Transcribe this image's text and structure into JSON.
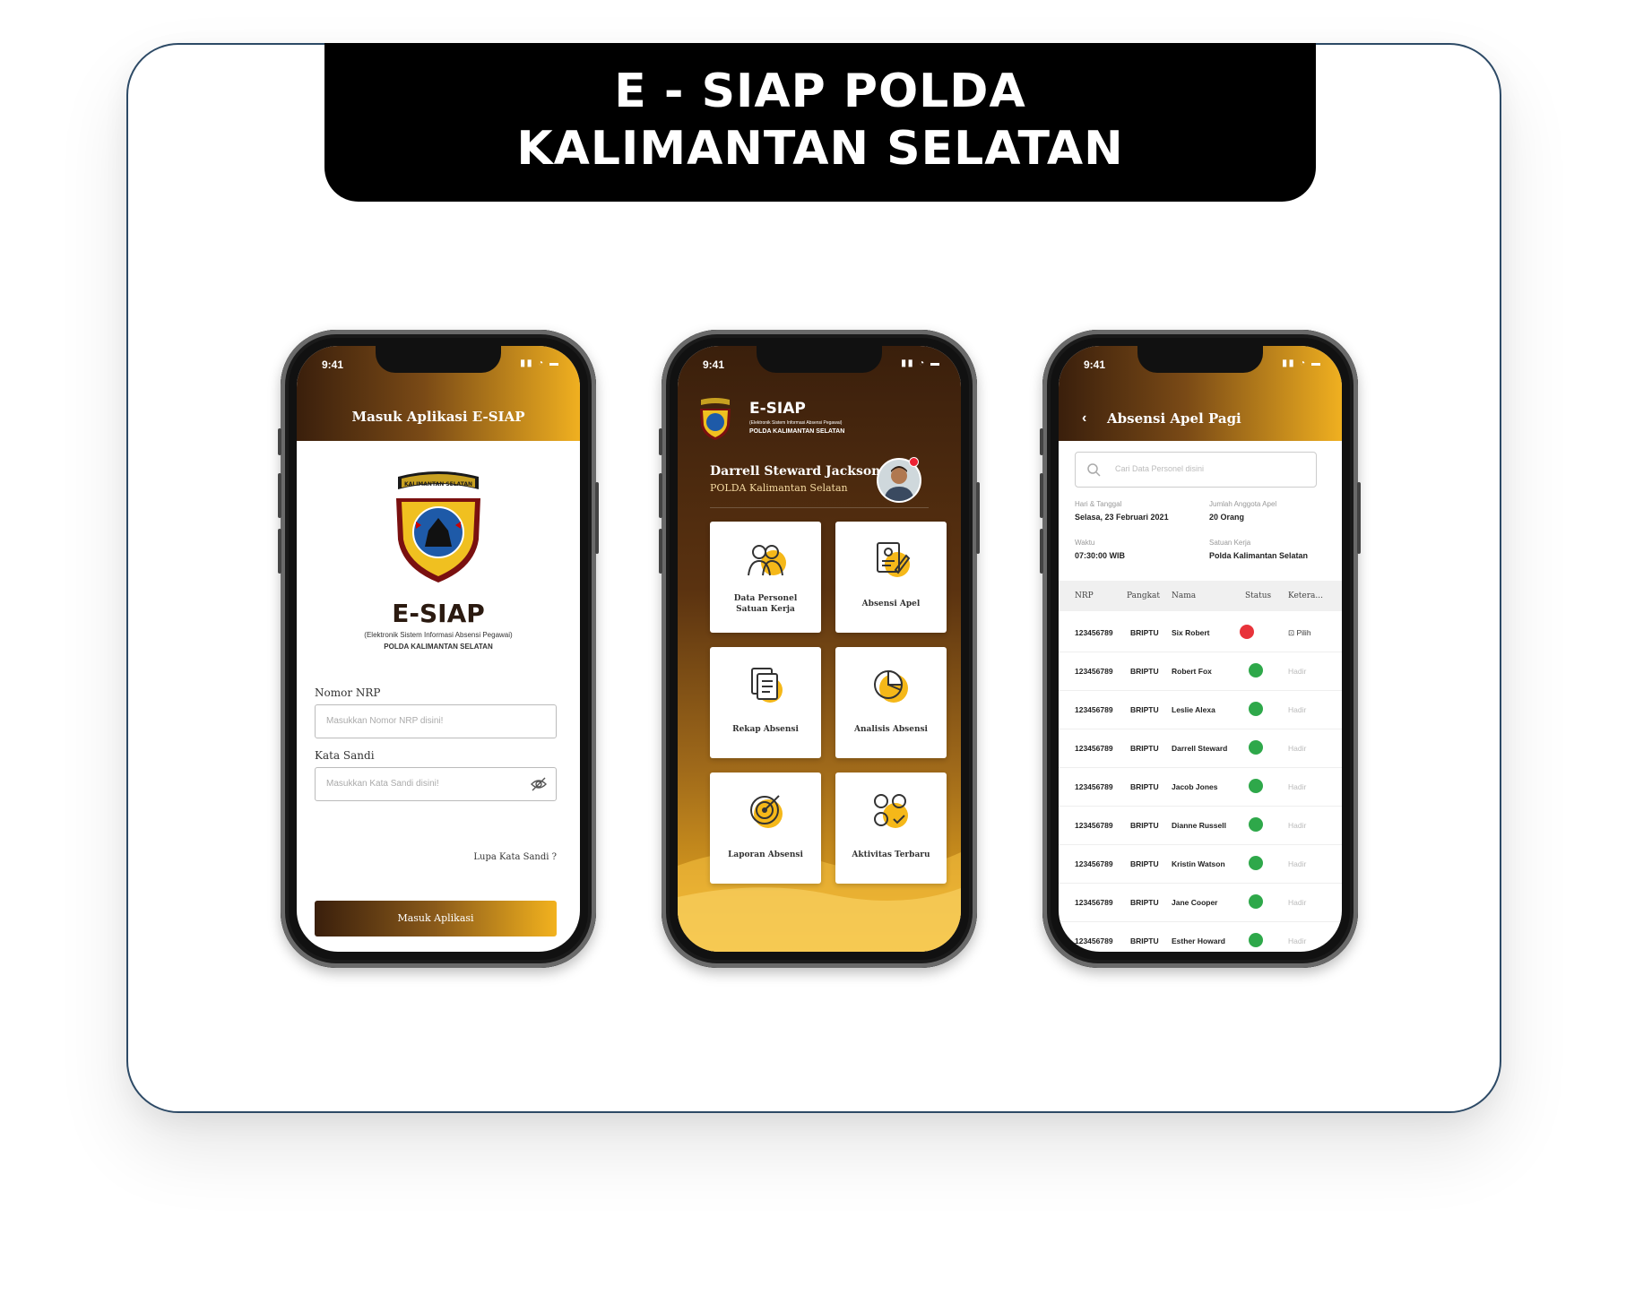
{
  "banner": {
    "line1": "E - SIAP POLDA",
    "line2": "KALIMANTAN SELATAN"
  },
  "status_time": "9:41",
  "login": {
    "header_title": "Masuk Aplikasi E-SIAP",
    "app_name": "E-SIAP",
    "app_subtitle": "(Elektronik Sistem Informasi Absensi Pegawai)",
    "org": "POLDA KALIMANTAN SELATAN",
    "logo_banner_text": "KALIMANTAN SELATAN",
    "nrp_label": "Nomor NRP",
    "nrp_placeholder": "Masukkan Nomor NRP disini!",
    "password_label": "Kata Sandi",
    "password_placeholder": "Masukkan Kata Sandi disini!",
    "forgot": "Lupa Kata Sandi ?",
    "submit": "Masuk Aplikasi"
  },
  "dashboard": {
    "app_name": "E-SIAP",
    "app_subtitle": "(Elektronik Sistem Informasi Absensi Pegawai)",
    "org": "POLDA KALIMANTAN SELATAN",
    "user_name": "Darrell Steward Jackson",
    "user_org": "POLDA Kalimantan Selatan",
    "tiles": [
      {
        "label1": "Data Personel",
        "label2": "Satuan Kerja",
        "icon": "personnel-icon"
      },
      {
        "label1": "Absensi Apel",
        "label2": "",
        "icon": "attendance-form-icon"
      },
      {
        "label1": "Rekap Absensi",
        "label2": "",
        "icon": "document-stack-icon"
      },
      {
        "label1": "Analisis Absensi",
        "label2": "",
        "icon": "pie-chart-icon"
      },
      {
        "label1": "Laporan Absensi",
        "label2": "",
        "icon": "target-icon"
      },
      {
        "label1": "Aktivitas Terbaru",
        "label2": "",
        "icon": "activity-icon"
      }
    ],
    "accent": "#f0b020"
  },
  "attendance": {
    "header_title": "Absensi Apel Pagi",
    "search_placeholder": "Cari Data Personel disini",
    "info": {
      "date_label": "Hari & Tanggal",
      "date_value": "Selasa, 23 Februari 2021",
      "count_label": "Jumlah Anggota Apel",
      "count_value": "20 Orang",
      "time_label": "Waktu",
      "time_value": "07:30:00 WIB",
      "unit_label": "Satuan Kerja",
      "unit_value": "Polda Kalimantan Selatan"
    },
    "columns": [
      "NRP",
      "Pangkat",
      "Nama",
      "Status",
      "Ketera..."
    ],
    "rows": [
      {
        "nrp": "123456789",
        "rank": "BRIPTU",
        "name": "Six Robert",
        "status": "red",
        "note": "Pilih"
      },
      {
        "nrp": "123456789",
        "rank": "BRIPTU",
        "name": "Robert Fox",
        "status": "green",
        "note": "Hadir"
      },
      {
        "nrp": "123456789",
        "rank": "BRIPTU",
        "name": "Leslie Alexa",
        "status": "green",
        "note": "Hadir"
      },
      {
        "nrp": "123456789",
        "rank": "BRIPTU",
        "name": "Darrell Steward",
        "status": "green",
        "note": "Hadir"
      },
      {
        "nrp": "123456789",
        "rank": "BRIPTU",
        "name": "Jacob Jones",
        "status": "green",
        "note": "Hadir"
      },
      {
        "nrp": "123456789",
        "rank": "BRIPTU",
        "name": "Dianne Russell",
        "status": "green",
        "note": "Hadir"
      },
      {
        "nrp": "123456789",
        "rank": "BRIPTU",
        "name": "Kristin Watson",
        "status": "green",
        "note": "Hadir"
      },
      {
        "nrp": "123456789",
        "rank": "BRIPTU",
        "name": "Jane Cooper",
        "status": "green",
        "note": "Hadir"
      },
      {
        "nrp": "123456789",
        "rank": "BRIPTU",
        "name": "Esther Howard",
        "status": "green",
        "note": "Hadir"
      }
    ],
    "status_colors": {
      "red": "#e8333a",
      "green": "#2ea84a"
    }
  }
}
